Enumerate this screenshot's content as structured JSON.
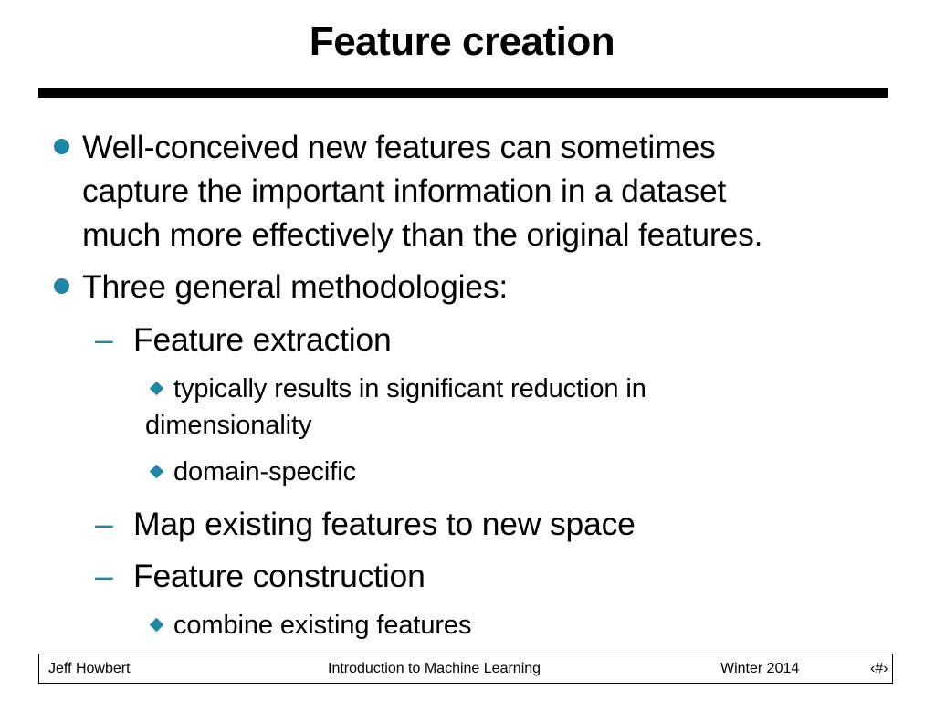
{
  "slide": {
    "title": "Feature creation",
    "bullets": [
      {
        "lines": [
          "Well-conceived new features can sometimes",
          "capture the important information in a dataset",
          "much more effectively than the original features."
        ]
      },
      {
        "text": "Three general methodologies:"
      }
    ],
    "methods": [
      {
        "dash": "–",
        "label": "Feature extraction",
        "sub": [
          {
            "lines": [
              "typically results in significant reduction in",
              "dimensionality"
            ]
          },
          {
            "text": "domain-specific"
          }
        ]
      },
      {
        "dash": "–",
        "label": "Map existing features to new space"
      },
      {
        "dash": "–",
        "label": "Feature construction",
        "sub": [
          {
            "text": "combine existing features"
          }
        ]
      }
    ]
  },
  "footer": {
    "author": "Jeff Howbert",
    "course": "Introduction to Machine Learning",
    "term": "Winter 2014",
    "slide_number": "‹#›"
  },
  "colors": {
    "bullet": "#1f87a6",
    "text": "#000000",
    "rule": "#000000"
  },
  "icons": {
    "level1": "round-bullet-icon",
    "level2": "dash",
    "level3": "diamond-bullet-icon"
  }
}
